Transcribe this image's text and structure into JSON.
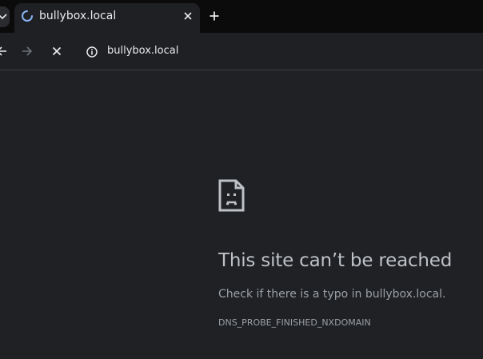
{
  "tab": {
    "title": "bullybox.local"
  },
  "address_bar": {
    "url": "bullybox.local"
  },
  "icons": {
    "tab_search": "chevron-down-icon",
    "tab_spinner": "loading-spinner-icon",
    "tab_close": "close-icon",
    "new_tab": "plus-icon",
    "back": "arrow-left-icon",
    "forward": "arrow-right-icon",
    "stop": "close-icon",
    "site_info": "info-icon",
    "error": "sad-document-icon"
  },
  "error_page": {
    "title": "This site can’t be reached",
    "description": "Check if there is a typo in bullybox.local.",
    "code": "DNS_PROBE_FINISHED_NXDOMAIN"
  },
  "colors": {
    "tabstrip_bg": "#0b0b0c",
    "toolbar_bg": "#1f2023",
    "page_bg": "#202124",
    "spinner": "#8ab4f8",
    "title_text": "#bdc1c6",
    "secondary_text": "#9aa0a6"
  }
}
